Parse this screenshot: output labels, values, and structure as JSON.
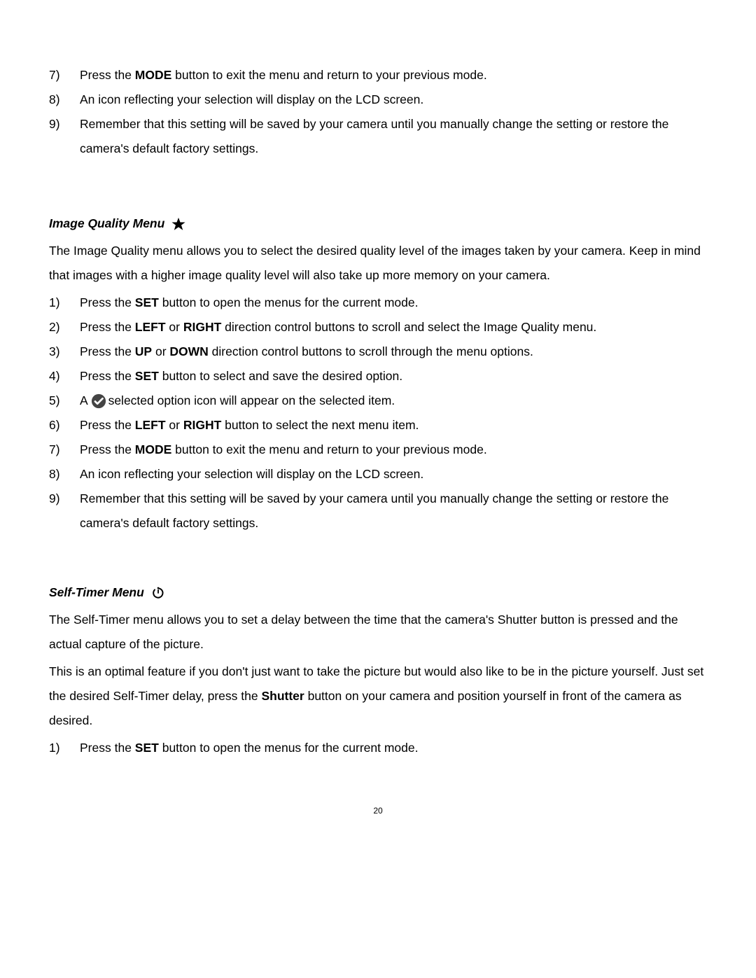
{
  "top_list": {
    "items": [
      {
        "num": "7)",
        "pre": "Press the ",
        "bold1": "MODE",
        "post": " button to exit the menu and return to your previous mode."
      },
      {
        "num": "8)",
        "plain": "An icon reflecting your selection will display on the LCD screen."
      },
      {
        "num": "9)",
        "plain": "Remember that this setting will be saved by your camera until you manually change the setting or restore the camera's default factory settings."
      }
    ]
  },
  "section1": {
    "heading": "Image Quality Menu",
    "intro": "The Image Quality menu allows you to select the desired quality level of the images taken by your camera. Keep in mind that images with a higher image quality level will also take up more memory on your camera.",
    "items": {
      "i1": {
        "num": "1)",
        "pre": "Press the ",
        "bold1": "SET",
        "post": " button to open the menus for the current mode."
      },
      "i2": {
        "num": "2)",
        "pre": "Press the ",
        "bold1": "LEFT",
        "mid": " or ",
        "bold2": "RIGHT",
        "post": " direction control buttons to scroll and select the Image Quality menu."
      },
      "i3": {
        "num": "3)",
        "pre": "Press the ",
        "bold1": "UP",
        "mid": " or ",
        "bold2": "DOWN",
        "post": " direction control buttons to scroll through the menu options."
      },
      "i4": {
        "num": "4)",
        "pre": "Press the ",
        "bold1": "SET",
        "post": " button to select and save the desired option."
      },
      "i5": {
        "num": "5)",
        "pre": "A ",
        "post": "selected option icon will appear on the selected item."
      },
      "i6": {
        "num": "6)",
        "pre": "Press the ",
        "bold1": "LEFT",
        "mid": " or ",
        "bold2": "RIGHT",
        "post": " button to select the next menu item."
      },
      "i7": {
        "num": "7)",
        "pre": "Press the ",
        "bold1": "MODE",
        "post": " button to exit the menu and return to your previous mode."
      },
      "i8": {
        "num": "8)",
        "plain": "An icon reflecting your selection will display on the LCD screen."
      },
      "i9": {
        "num": "9)",
        "plain": "Remember that this setting will be saved by your camera until you manually change the setting or restore the camera's default factory settings."
      }
    }
  },
  "section2": {
    "heading": "Self-Timer Menu",
    "intro1": "The Self-Timer menu allows you to set a delay between the time that the camera's Shutter button is pressed and the actual capture of the picture.",
    "intro2_pre": "This is an optimal feature if you don't just want to take the picture but would also like to be in the picture yourself. Just set the desired Self-Timer delay, press the ",
    "intro2_bold": "Shutter",
    "intro2_post": " button on your camera and position yourself in front of the camera as desired.",
    "items": {
      "i1": {
        "num": "1)",
        "pre": "Press the ",
        "bold1": "SET",
        "post": " button to open the menus for the current mode."
      }
    }
  },
  "page_number": "20"
}
